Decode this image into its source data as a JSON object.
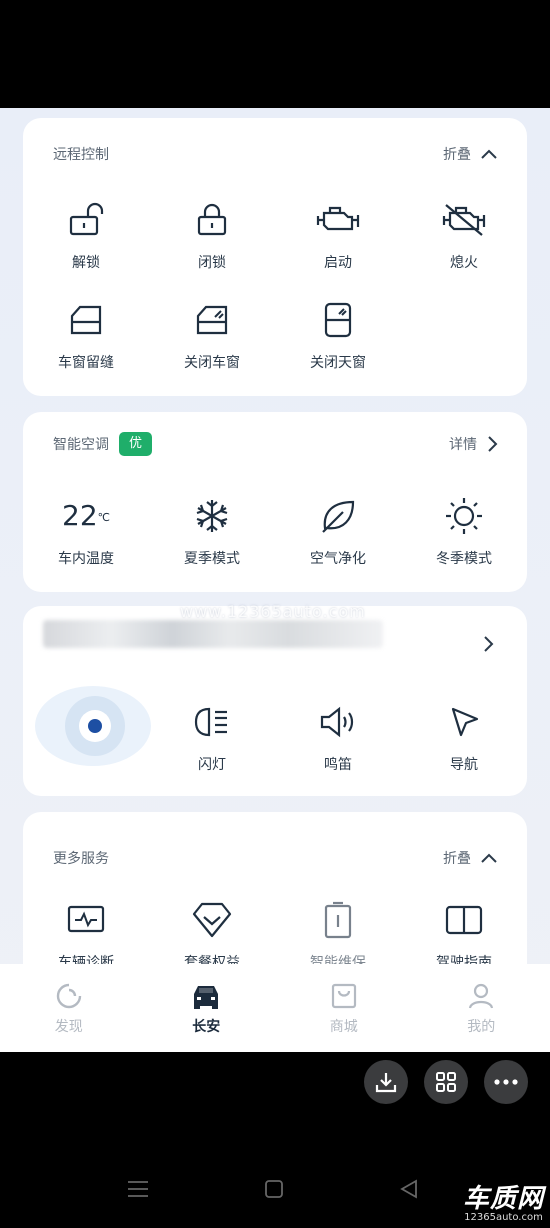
{
  "remote": {
    "title": "远程控制",
    "action": "折叠",
    "items": [
      {
        "label": "解锁",
        "icon": "unlock-icon"
      },
      {
        "label": "闭锁",
        "icon": "lock-icon"
      },
      {
        "label": "启动",
        "icon": "engine-start-icon"
      },
      {
        "label": "熄火",
        "icon": "engine-off-icon"
      },
      {
        "label": "车窗留缝",
        "icon": "window-gap-icon"
      },
      {
        "label": "关闭车窗",
        "icon": "window-close-icon"
      },
      {
        "label": "关闭天窗",
        "icon": "sunroof-close-icon"
      }
    ]
  },
  "ac": {
    "title": "智能空调",
    "badge": "优",
    "action": "详情",
    "temp_value": "22",
    "temp_unit": "℃",
    "items": [
      {
        "label": "车内温度"
      },
      {
        "label": "夏季模式",
        "icon": "snowflake-icon"
      },
      {
        "label": "空气净化",
        "icon": "leaf-icon"
      },
      {
        "label": "冬季模式",
        "icon": "sun-icon"
      }
    ]
  },
  "vehicle": {
    "items": [
      {
        "label": "闪灯",
        "icon": "headlight-icon"
      },
      {
        "label": "鸣笛",
        "icon": "horn-icon"
      },
      {
        "label": "导航",
        "icon": "navigation-icon"
      }
    ]
  },
  "watermark": "www.12365auto.com",
  "services": {
    "title": "更多服务",
    "action": "折叠",
    "items": [
      {
        "label": "车辆诊断",
        "icon": "diagnosis-icon"
      },
      {
        "label": "套餐权益",
        "icon": "package-icon"
      },
      {
        "label": "智能维保",
        "icon": "maintenance-icon"
      },
      {
        "label": "驾驶指南",
        "icon": "guide-book-icon"
      }
    ]
  },
  "tabbar": [
    {
      "label": "发现",
      "icon": "discover-icon",
      "active": false
    },
    {
      "label": "长安",
      "icon": "car-icon",
      "active": true
    },
    {
      "label": "商城",
      "icon": "mall-icon",
      "active": false
    },
    {
      "label": "我的",
      "icon": "profile-icon",
      "active": false
    }
  ],
  "brand": {
    "name": "车质网",
    "url": "12365auto.com"
  },
  "colors": {
    "accent_green": "#1fae6a",
    "icon_dark": "#1f2f40",
    "tab_inactive": "#b4bac2"
  }
}
